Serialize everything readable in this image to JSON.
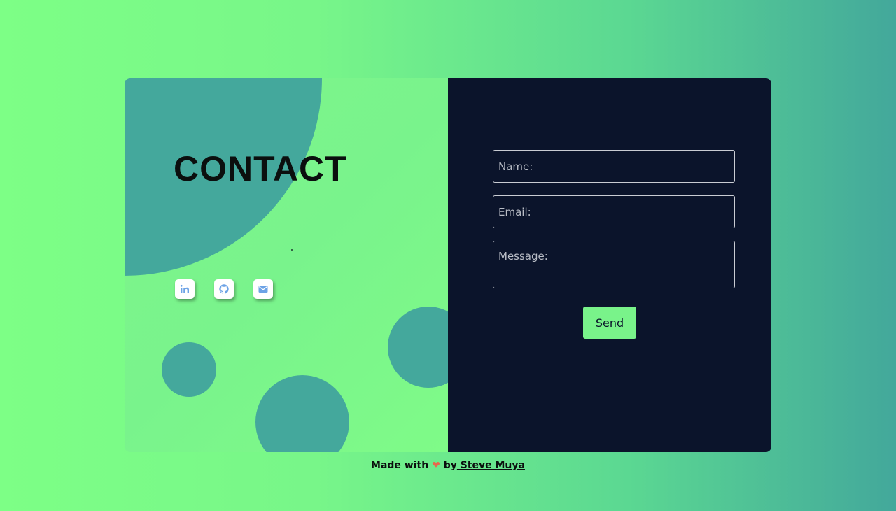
{
  "contact": {
    "title": "CONTACT",
    "socials": [
      {
        "name": "linkedin",
        "icon": "linkedin-icon",
        "label": "in"
      },
      {
        "name": "github",
        "icon": "github-icon"
      },
      {
        "name": "email",
        "icon": "mail-icon"
      }
    ]
  },
  "form": {
    "name_placeholder": "Name:",
    "email_placeholder": "Email:",
    "message_placeholder": "Message:",
    "send_label": "Send"
  },
  "footer": {
    "prefix": "Made with",
    "heart": "❤",
    "by": "by",
    "author": " Steve Muya"
  },
  "colors": {
    "accent_green": "#79f38a",
    "teal_blob": "#44a89c",
    "form_background": "#0b142b",
    "social_icon": "#6da3e6",
    "heart": "#e8684c"
  }
}
